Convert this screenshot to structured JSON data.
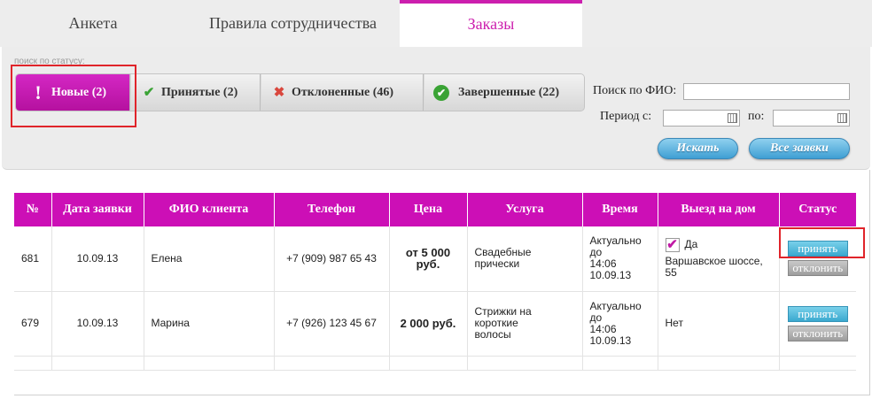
{
  "tabs": [
    {
      "label": "Анкета"
    },
    {
      "label": "Правила сотрудничества"
    },
    {
      "label": "Заказы"
    }
  ],
  "filters": {
    "status_caption": "поиск по статусу:",
    "statuses": [
      {
        "label": "Новые (2)",
        "icon": "exclamation-icon"
      },
      {
        "label": "Принятые (2)",
        "icon": "check-icon"
      },
      {
        "label": "Отклоненные (46)",
        "icon": "cross-icon"
      },
      {
        "label": "Завершенные (22)",
        "icon": "check-circle-icon"
      }
    ],
    "fio_label": "Поиск по ФИО:",
    "fio_value": "",
    "period_from_label": "Период с:",
    "period_to_label": "по:",
    "period_from_value": "",
    "period_to_value": "",
    "search_button": "Искать",
    "all_button": "Все заявки"
  },
  "table": {
    "headers": [
      "№",
      "Дата заявки",
      "ФИО клиента",
      "Телефон",
      "Цена",
      "Услуга",
      "Время",
      "Выезд на дом",
      "Статус"
    ],
    "rows": [
      {
        "num": "681",
        "date": "10.09.13",
        "client": "Елена",
        "phone": "+7 (909) 987 65 43",
        "price": "от 5 000 руб.",
        "service_l1": "Свадебные",
        "service_l2": "прически",
        "service_l3": "",
        "time_l1": "Актуально",
        "time_l2": "до",
        "time_l3": "14:06",
        "time_l4": "10.09.13",
        "visit_yes": "Да",
        "visit_address": "Варшавское шоссе, 55",
        "accept": "принять",
        "decline": "отклонить"
      },
      {
        "num": "679",
        "date": "10.09.13",
        "client": "Марина",
        "phone": "+7 (926) 123 45 67",
        "price": "2 000 руб.",
        "service_l1": "Стрижки на",
        "service_l2": "короткие",
        "service_l3": "волосы",
        "time_l1": "Актуально",
        "time_l2": "до",
        "time_l3": "14:06",
        "time_l4": "10.09.13",
        "visit": "Нет",
        "accept": "принять",
        "decline": "отклонить"
      }
    ]
  },
  "colors": {
    "accent": "#cc0fb6",
    "accept_button": "#3aa9cf",
    "decline_button": "#9d9d9d",
    "highlight_frame": "#e0242a"
  }
}
